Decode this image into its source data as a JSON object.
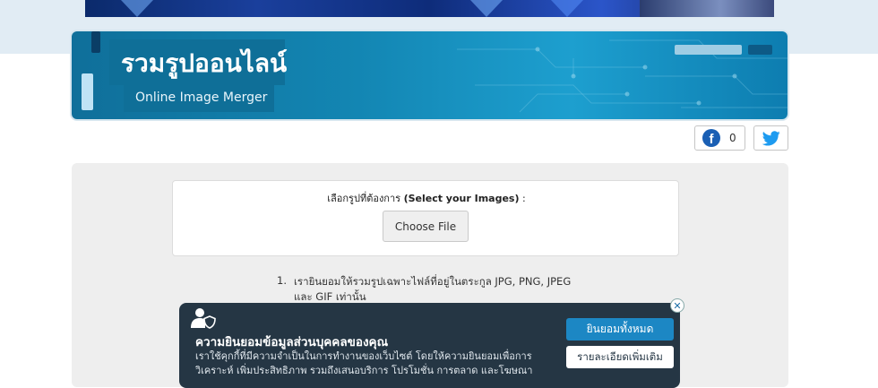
{
  "hero": {
    "title": "รวมรูปออนไลน์",
    "subtitle": "Online Image Merger"
  },
  "share": {
    "facebook_icon": "facebook-icon",
    "facebook_count": "0",
    "twitter_icon": "twitter-icon"
  },
  "upload": {
    "label_thai": "เลือกรูปที่ต้องการ ",
    "label_en": "(Select your Images)",
    "label_suffix": " :",
    "button_label": "Choose File"
  },
  "rules": [
    {
      "number": "1.",
      "text": "เรายินยอมให้รวมรูปเฉพาะไฟล์ที่อยู่ในตระกูล JPG, PNG, JPEG และ GIF เท่านั้น"
    }
  ],
  "consent": {
    "icon": "user-shield-icon",
    "title": "ความยินยอมข้อมูลส่วนบุคคลของคุณ",
    "body": "เราใช้คุกกี้ที่มีความจำเป็นในการทำงานของเว็บไซต์ โดยให้ความยินยอมเพื่อการวิเคราะห์ เพิ่มประสิทธิภาพ รวมถึงเสนอบริการ โปรโมชั่น การตลาด และโฆษณา",
    "accept_label": "ยินยอมทั้งหมด",
    "details_label": "รายละเอียดเพิ่มเติม",
    "close_icon": "close-icon"
  },
  "colors": {
    "hero_blue": "#1386b3",
    "consent_bg": "#253644",
    "accept_blue": "#1c87c4",
    "facebook_blue": "#1a5fb4",
    "twitter_blue": "#1d9bf0"
  }
}
